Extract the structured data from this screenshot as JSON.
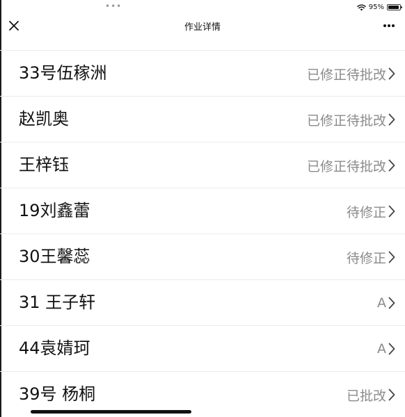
{
  "status_bar": {
    "dots": "•••",
    "battery_percent": "95%",
    "battery_level": 0.95,
    "icons": [
      "wifi-icon",
      "battery-icon"
    ]
  },
  "nav": {
    "title": "作业详情",
    "close_icon": "close-icon",
    "more_icon": "more-icon"
  },
  "students": [
    {
      "name": "33号伍稼洲",
      "status": "已修正待批改"
    },
    {
      "name": "赵凯奥",
      "status": "已修正待批改"
    },
    {
      "name": "王梓钰",
      "status": "已修正待批改"
    },
    {
      "name": "19刘鑫蕾",
      "status": "待修正"
    },
    {
      "name": "30王馨蕊",
      "status": "待修正"
    },
    {
      "name": "31 王子轩",
      "status": "A"
    },
    {
      "name": "44袁婧珂",
      "status": "A"
    },
    {
      "name": "39号 杨桐",
      "status": "已批改"
    }
  ],
  "colors": {
    "text_primary": "#111111",
    "text_secondary": "#8a8a8a",
    "divider": "#ebebeb",
    "background": "#ffffff"
  }
}
